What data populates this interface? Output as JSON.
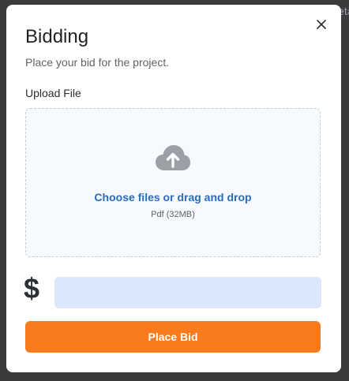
{
  "backdrop": {
    "partial_text": "eta"
  },
  "modal": {
    "title": "Bidding",
    "subtitle": "Place your bid for the project.",
    "close_icon": "close-icon"
  },
  "upload": {
    "label": "Upload File",
    "icon": "cloud-upload-icon",
    "prompt": "Choose files or drag and drop",
    "hint": "Pdf (32MB)"
  },
  "bid": {
    "currency_symbol": "$",
    "amount_value": "",
    "amount_placeholder": ""
  },
  "actions": {
    "submit_label": "Place Bid"
  },
  "colors": {
    "accent_orange": "#f97b1e",
    "link_blue": "#2c6cb8",
    "input_bg": "#dbe8fb",
    "dropzone_bg": "#f6f9fd",
    "backdrop": "#3a3b3d"
  }
}
